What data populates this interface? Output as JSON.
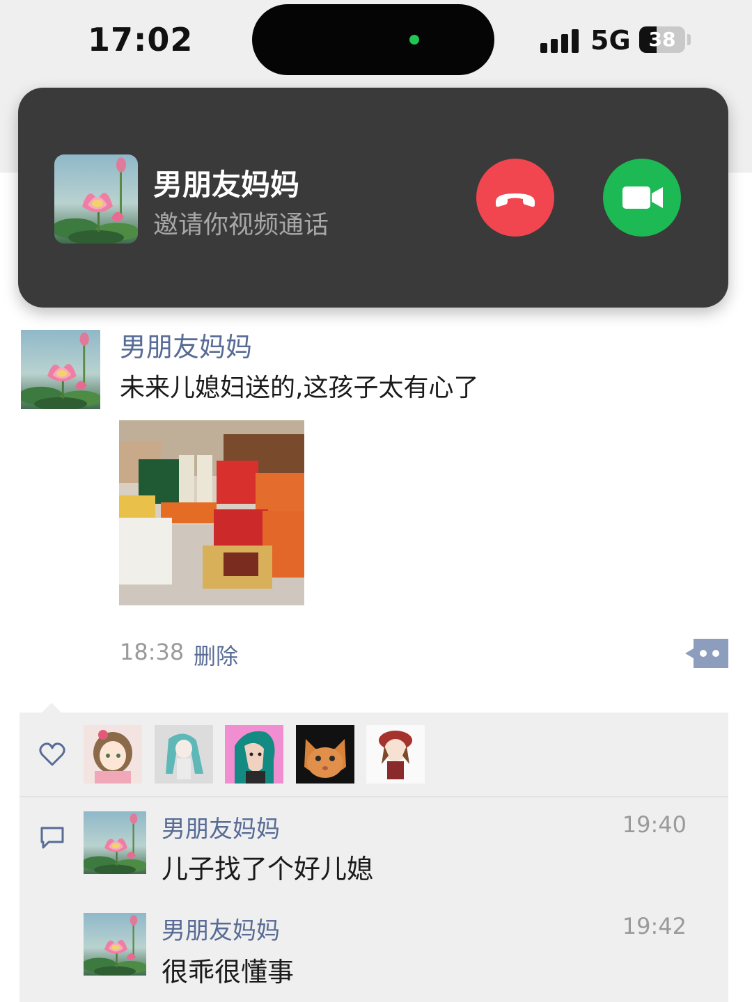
{
  "status_bar": {
    "time": "17:02",
    "network": "5G",
    "battery": "38",
    "battery_level": 0.38
  },
  "call_banner": {
    "caller_name": "男朋友妈妈",
    "subtitle": "邀请你视频通话",
    "decline_icon": "phone-hangup-icon",
    "accept_icon": "video-camera-icon",
    "decline_color": "#f1454f",
    "accept_color": "#1db954"
  },
  "post": {
    "author": "男朋友妈妈",
    "text": "未来儿媳妇送的,这孩子太有心了",
    "time": "18:38",
    "delete_label": "删除",
    "more_icon": "more-dots-icon",
    "name_color": "#576b95"
  },
  "likes": {
    "icon": "heart-icon",
    "users": [
      {
        "avatar": "anime-girl-avatar"
      },
      {
        "avatar": "miku-avatar"
      },
      {
        "avatar": "teal-hair-portrait-avatar"
      },
      {
        "avatar": "orange-cat-avatar"
      },
      {
        "avatar": "red-hat-chibi-avatar"
      }
    ]
  },
  "comments": {
    "icon": "comment-icon",
    "items": [
      {
        "author": "男朋友妈妈",
        "time": "19:40",
        "text": "儿子找了个好儿媳"
      },
      {
        "author": "男朋友妈妈",
        "time": "19:42",
        "text": "很乖很懂事"
      }
    ]
  }
}
